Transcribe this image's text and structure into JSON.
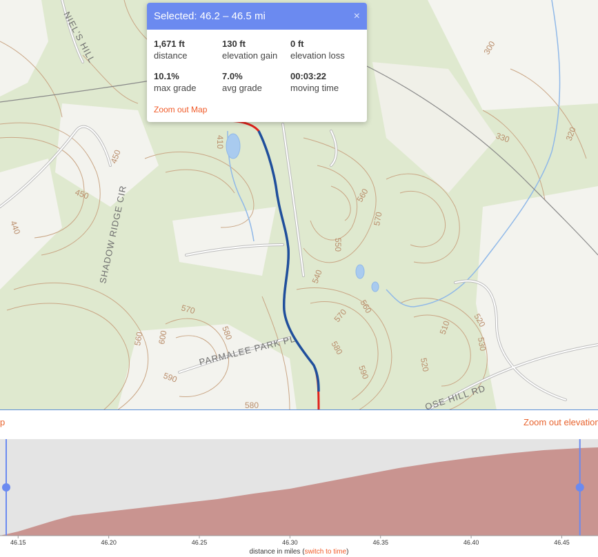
{
  "popup": {
    "title": "Selected: 46.2 – 46.5 mi",
    "close_glyph": "×",
    "stats": [
      {
        "value": "1,671 ft",
        "label": "distance"
      },
      {
        "value": "130 ft",
        "label": "elevation gain"
      },
      {
        "value": "0 ft",
        "label": "elevation loss"
      },
      {
        "value": "10.1%",
        "label": "max grade"
      },
      {
        "value": "7.0%",
        "label": "avg grade"
      },
      {
        "value": "00:03:22",
        "label": "moving time"
      }
    ],
    "zoom_out_map": "Zoom out Map"
  },
  "map": {
    "road_labels": [
      "NIEL'S HILL",
      "SHADOW RIDGE CIR",
      "PARMALEE PARK PL",
      "OSE HILL RD"
    ],
    "contour_labels": [
      "300",
      "330",
      "320",
      "410",
      "450",
      "440",
      "560",
      "570",
      "550",
      "540",
      "570",
      "560",
      "570",
      "600",
      "580",
      "590",
      "560",
      "580",
      "590",
      "510",
      "520",
      "530",
      "520",
      "580",
      "450"
    ],
    "colors": {
      "route_selected": "#1f4f9c",
      "route": "#e0211b",
      "water": "#8fb8e8",
      "contour": "#c9a584"
    }
  },
  "elevation": {
    "left_link": "p",
    "right_link": "Zoom out elevation",
    "x_axis_title": "distance in miles",
    "switch_prefix": "(",
    "switch_link": "switch to time",
    "switch_suffix": ")",
    "ticks": [
      "46.15",
      "46.20",
      "46.25",
      "46.30",
      "46.35",
      "46.40",
      "46.45"
    ],
    "colors": {
      "fill": "#c99490",
      "background": "#e4e4e4",
      "handle": "#6b8af0"
    }
  },
  "chart_data": {
    "type": "area",
    "x": [
      46.14,
      46.15,
      46.16,
      46.17,
      46.18,
      46.2,
      46.22,
      46.24,
      46.26,
      46.28,
      46.3,
      46.32,
      46.34,
      46.36,
      46.38,
      46.4,
      46.42,
      46.44,
      46.46,
      46.47
    ],
    "y": [
      0,
      6,
      14,
      22,
      29,
      35,
      41,
      47,
      53,
      61,
      68,
      78,
      88,
      98,
      106,
      113,
      119,
      124,
      127,
      128
    ],
    "xlim": [
      46.14,
      46.47
    ],
    "ylim": [
      0,
      140
    ],
    "selection": [
      46.14,
      46.46
    ],
    "xlabel": "distance in miles",
    "grid": false
  }
}
